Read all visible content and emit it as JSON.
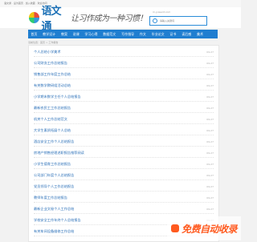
{
  "topbar": {
    "text": "语文通 · 设为首页 · 加入收藏 · 欢迎访问"
  },
  "header": {
    "logo_text": "语文通",
    "slogan": "让习作成为一种习惯！",
    "site_url": "m.yuwent.com",
    "search_placeholder": "请输入关键词"
  },
  "nav": {
    "items": [
      "首页",
      "教学设计",
      "教案",
      "说课",
      "学习心得",
      "数据范文",
      "写作指导",
      "作文",
      "毕业论文",
      "证书",
      "读后感",
      "美术"
    ]
  },
  "breadcrumb": "当前位置：首页 > 工作报告",
  "list": {
    "rows": [
      {
        "title": "个人总结小学美术",
        "date": "09-27"
      },
      {
        "title": "公司财务工作总结报告",
        "date": "09-27"
      },
      {
        "title": "销售部工作年度工作总结",
        "date": "09-27"
      },
      {
        "title": "有关数学教研组活动总结",
        "date": "09-27"
      },
      {
        "title": "小学期末数学主任个人总结报告",
        "date": "09-27"
      },
      {
        "title": "最新农民工工作总结报告",
        "date": "09-27"
      },
      {
        "title": "机关个人工作总结范文",
        "date": "09-27"
      },
      {
        "title": "大学生素质拓展个人总结",
        "date": "09-27"
      },
      {
        "title": "酒店安全工作个人总结报告",
        "date": "09-27"
      },
      {
        "title": "房地产销售经理述职报告推荐阅读",
        "date": "09-27"
      },
      {
        "title": "小学生德育工作总结报告",
        "date": "09-27"
      },
      {
        "title": "公司部门年度个人总结报告",
        "date": "09-27"
      },
      {
        "title": "党员领导个人工作总结报告",
        "date": "09-27"
      },
      {
        "title": "教师年度工作总结报告",
        "date": "09-27"
      },
      {
        "title": "最新企业文秘个人工作总结",
        "date": "09-27"
      },
      {
        "title": "学校安全工作年终个人总结报告",
        "date": "09-27"
      },
      {
        "title": "有关车间设备维修工作总结",
        "date": "09-27"
      }
    ]
  },
  "watermark": {
    "text": "免费自动收录"
  }
}
